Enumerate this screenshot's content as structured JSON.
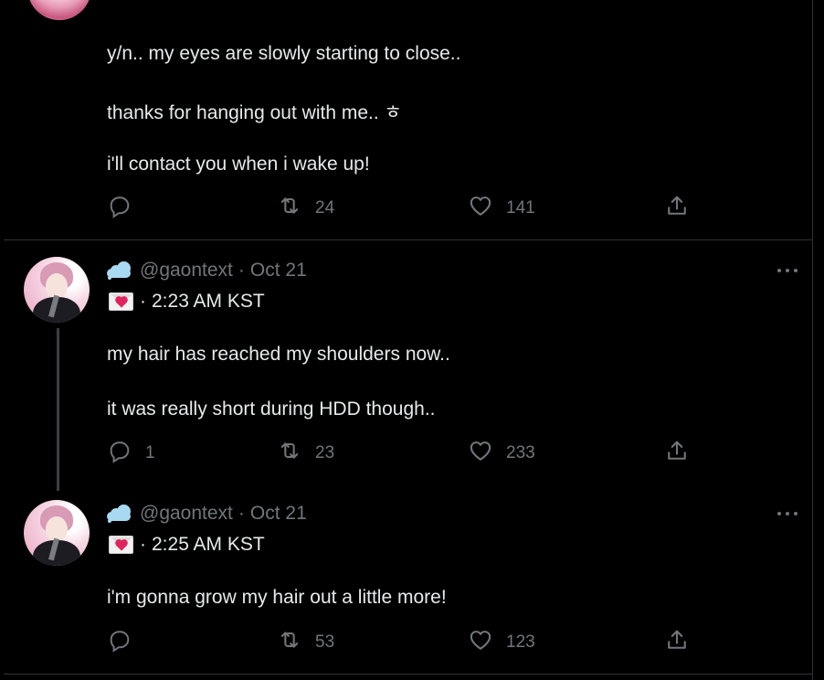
{
  "tweets": [
    {
      "lines": [
        "y/n.. my eyes are slowly starting to close..",
        "thanks for hanging out with me.. ㅎ",
        "i'll contact you when i wake up!"
      ],
      "replies": "",
      "retweets": "24",
      "likes": "141"
    },
    {
      "handle": "@gaontext",
      "date": "Oct 21",
      "time": "2:23 AM KST",
      "lines": [
        "my hair has reached my shoulders now..",
        "it was really short during HDD though.."
      ],
      "replies": "1",
      "retweets": "23",
      "likes": "233"
    },
    {
      "handle": "@gaontext",
      "date": "Oct 21",
      "time": "2:25 AM KST",
      "lines": [
        "i'm gonna grow my hair out a little more!"
      ],
      "replies": "",
      "retweets": "53",
      "likes": "123"
    }
  ],
  "separator": "·",
  "icons": {
    "name_emoji": "cloud-emoji-icon",
    "subtitle_emoji": "love-letter-emoji-icon",
    "reply": "reply-icon",
    "retweet": "retweet-icon",
    "like": "heart-icon",
    "share": "share-icon",
    "more": "more-icon"
  },
  "colors": {
    "background": "#000000",
    "text": "#e7e9ea",
    "muted": "#71767b",
    "divider": "#2f3336"
  }
}
